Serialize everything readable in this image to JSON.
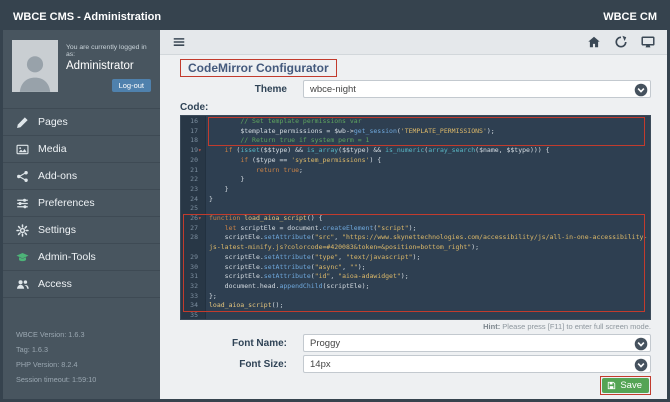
{
  "window": {
    "title": "WBCE CMS - Administration",
    "brand_right": "WBCE CM"
  },
  "sidebar": {
    "login_note": "You are currently logged in as:",
    "username": "Administrator",
    "logout_label": "Log-out",
    "items": [
      {
        "id": "pages",
        "label": "Pages",
        "icon": "pencil-icon"
      },
      {
        "id": "media",
        "label": "Media",
        "icon": "image-icon"
      },
      {
        "id": "addons",
        "label": "Add-ons",
        "icon": "addons-icon"
      },
      {
        "id": "preferences",
        "label": "Preferences",
        "icon": "sliders-icon"
      },
      {
        "id": "settings",
        "label": "Settings",
        "icon": "gear-icon"
      },
      {
        "id": "admin-tools",
        "label": "Admin-Tools",
        "icon": "graduation-cap-icon",
        "icon_color": "#4db378"
      },
      {
        "id": "access",
        "label": "Access",
        "icon": "users-icon"
      }
    ],
    "footer_lines": [
      "WBCE Version: 1.6.3",
      "Tag: 1.6.3",
      "PHP Version: 8.2.4",
      "Session timeout: 1:59:10"
    ]
  },
  "toolbar": {
    "left_icon": "menu-icon",
    "right_icons": [
      "home-icon",
      "back-icon",
      "display-icon"
    ]
  },
  "page": {
    "title": "CodeMirror Configurator",
    "theme_label": "Theme",
    "theme_value": "wbce-night",
    "code_label": "Code:",
    "hint_label": "Hint:",
    "hint_text": " Please press [F11] to enter full screen mode.",
    "font_name_label": "Font Name:",
    "font_name_value": "Proggy",
    "font_size_label": "Font Size:",
    "font_size_value": "14px",
    "save_label": "Save"
  },
  "annotations": {
    "color": "#c23b2d",
    "boxes": [
      "page-title",
      "code-lines-16-18",
      "code-lines-26-34",
      "save-button"
    ]
  },
  "editor": {
    "first_line": 16,
    "last_line": 35,
    "lines": [
      {
        "no": 16,
        "fold": false,
        "tokens": [
          {
            "t": "        // Set template permissions var",
            "c": "cmt"
          }
        ]
      },
      {
        "no": 17,
        "fold": false,
        "tokens": [
          {
            "t": "        $template_permissions = $wb->",
            "c": "v"
          },
          {
            "t": "get_session",
            "c": "prop"
          },
          {
            "t": "(",
            "c": "v"
          },
          {
            "t": "'TEMPLATE_PERMISSIONS'",
            "c": "str"
          },
          {
            "t": ");",
            "c": "v"
          }
        ]
      },
      {
        "no": 18,
        "fold": false,
        "tokens": [
          {
            "t": "        // Return true if system perm = 1",
            "c": "cmt"
          }
        ]
      },
      {
        "no": 19,
        "fold": true,
        "tokens": [
          {
            "t": "    ",
            "c": "v"
          },
          {
            "t": "if",
            "c": "kw"
          },
          {
            "t": " (",
            "c": "v"
          },
          {
            "t": "isset",
            "c": "bi"
          },
          {
            "t": "($$type) && ",
            "c": "v"
          },
          {
            "t": "is_array",
            "c": "bi"
          },
          {
            "t": "($$type) && ",
            "c": "v"
          },
          {
            "t": "is_numeric",
            "c": "bi"
          },
          {
            "t": "(",
            "c": "v"
          },
          {
            "t": "array_search",
            "c": "bi"
          },
          {
            "t": "($name, $$type))) {",
            "c": "v"
          }
        ]
      },
      {
        "no": 20,
        "fold": false,
        "tokens": [
          {
            "t": "        ",
            "c": "v"
          },
          {
            "t": "if",
            "c": "kw"
          },
          {
            "t": " ($type == ",
            "c": "v"
          },
          {
            "t": "'system_permissions'",
            "c": "str"
          },
          {
            "t": ") {",
            "c": "v"
          }
        ]
      },
      {
        "no": 21,
        "fold": false,
        "tokens": [
          {
            "t": "            ",
            "c": "v"
          },
          {
            "t": "return",
            "c": "kw"
          },
          {
            "t": " ",
            "c": "v"
          },
          {
            "t": "true",
            "c": "kw"
          },
          {
            "t": ";",
            "c": "v"
          }
        ]
      },
      {
        "no": 22,
        "fold": false,
        "tokens": [
          {
            "t": "        }",
            "c": "v"
          }
        ]
      },
      {
        "no": 23,
        "fold": false,
        "tokens": [
          {
            "t": "    }",
            "c": "v"
          }
        ]
      },
      {
        "no": 24,
        "fold": false,
        "tokens": [
          {
            "t": "}",
            "c": "v"
          }
        ]
      },
      {
        "no": 25,
        "fold": false,
        "tokens": []
      },
      {
        "no": 26,
        "fold": true,
        "tokens": [
          {
            "t": "function",
            "c": "kw"
          },
          {
            "t": " ",
            "c": "v"
          },
          {
            "t": "load_aioa_script",
            "c": "def"
          },
          {
            "t": "() {",
            "c": "v"
          }
        ]
      },
      {
        "no": 27,
        "fold": false,
        "tokens": [
          {
            "t": "    ",
            "c": "v"
          },
          {
            "t": "let",
            "c": "kw"
          },
          {
            "t": " scriptEle = document.",
            "c": "v"
          },
          {
            "t": "createElement",
            "c": "prop"
          },
          {
            "t": "(",
            "c": "v"
          },
          {
            "t": "\"script\"",
            "c": "str"
          },
          {
            "t": ");",
            "c": "v"
          }
        ]
      },
      {
        "no": 28,
        "fold": false,
        "tokens": [
          {
            "t": "    scriptEle.",
            "c": "v"
          },
          {
            "t": "setAttribute",
            "c": "prop"
          },
          {
            "t": "(",
            "c": "v"
          },
          {
            "t": "\"src\"",
            "c": "str"
          },
          {
            "t": ", ",
            "c": "v"
          },
          {
            "t": "\"https://www.skynettechnologies.com/accessibility/js/all-in-one-accessibility-js-latest-minify.js?colorcode=#420083&token=&position=bottom_right\"",
            "c": "str"
          },
          {
            "t": ");",
            "c": "v"
          }
        ]
      },
      {
        "no": 29,
        "fold": false,
        "tokens": [
          {
            "t": "    scriptEle.",
            "c": "v"
          },
          {
            "t": "setAttribute",
            "c": "prop"
          },
          {
            "t": "(",
            "c": "v"
          },
          {
            "t": "\"type\"",
            "c": "str"
          },
          {
            "t": ", ",
            "c": "v"
          },
          {
            "t": "\"text/javascript\"",
            "c": "str"
          },
          {
            "t": ");",
            "c": "v"
          }
        ]
      },
      {
        "no": 30,
        "fold": false,
        "tokens": [
          {
            "t": "    scriptEle.",
            "c": "v"
          },
          {
            "t": "setAttribute",
            "c": "prop"
          },
          {
            "t": "(",
            "c": "v"
          },
          {
            "t": "\"async\"",
            "c": "str"
          },
          {
            "t": ", ",
            "c": "v"
          },
          {
            "t": "\"\"",
            "c": "str"
          },
          {
            "t": ");",
            "c": "v"
          }
        ]
      },
      {
        "no": 31,
        "fold": false,
        "tokens": [
          {
            "t": "    scriptEle.",
            "c": "v"
          },
          {
            "t": "setAttribute",
            "c": "prop"
          },
          {
            "t": "(",
            "c": "v"
          },
          {
            "t": "\"id\"",
            "c": "str"
          },
          {
            "t": ", ",
            "c": "v"
          },
          {
            "t": "\"aioa-adawidget\"",
            "c": "str"
          },
          {
            "t": ");",
            "c": "v"
          }
        ]
      },
      {
        "no": 32,
        "fold": false,
        "tokens": [
          {
            "t": "    document.head.",
            "c": "v"
          },
          {
            "t": "appendChild",
            "c": "prop"
          },
          {
            "t": "(scriptEle);",
            "c": "v"
          }
        ]
      },
      {
        "no": 33,
        "fold": false,
        "tokens": [
          {
            "t": "};",
            "c": "v"
          }
        ]
      },
      {
        "no": 34,
        "fold": false,
        "tokens": [
          {
            "t": "load_aioa_script",
            "c": "def"
          },
          {
            "t": "();",
            "c": "v"
          }
        ]
      },
      {
        "no": 35,
        "fold": false,
        "tokens": []
      }
    ]
  }
}
